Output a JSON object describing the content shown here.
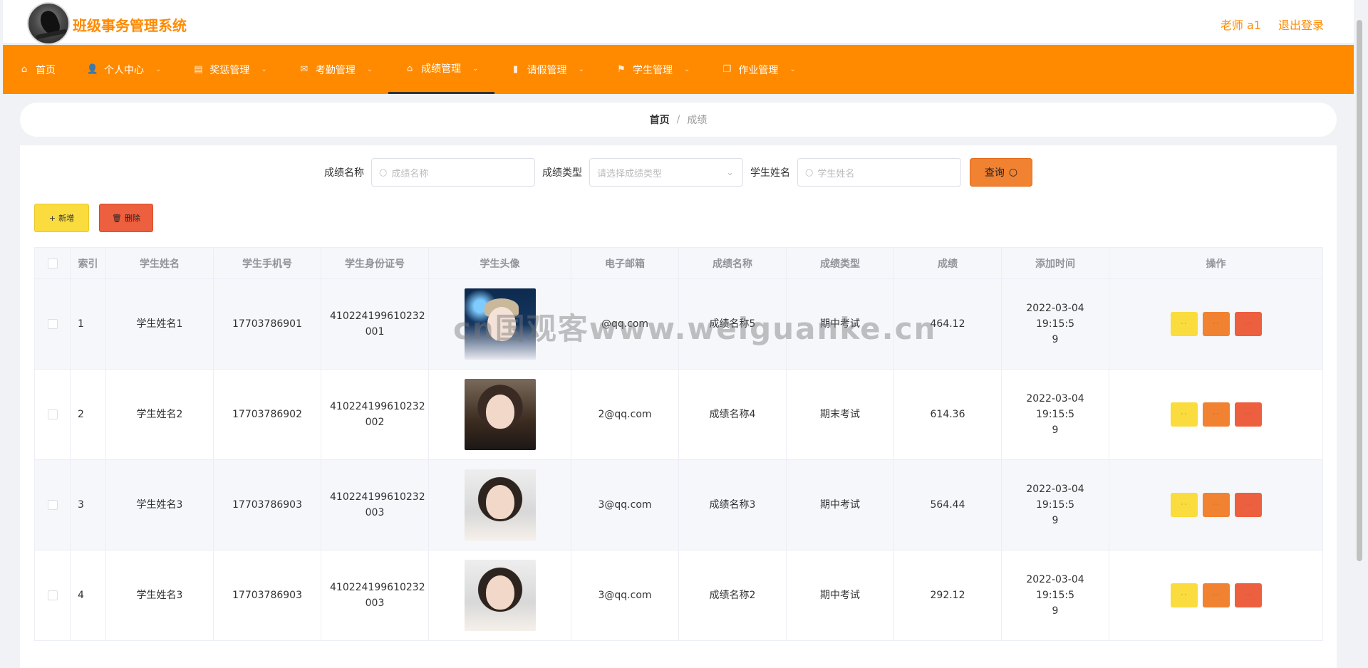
{
  "app": {
    "title": "班级事务管理系统",
    "user_label": "老师 a1",
    "logout_label": "退出登录"
  },
  "nav": [
    {
      "label": "首页",
      "icon": "home-icon",
      "glyph": "⌂",
      "active": false
    },
    {
      "label": "个人中心",
      "icon": "user-icon",
      "glyph": "👤",
      "active": false
    },
    {
      "label": "奖惩管理",
      "icon": "clipboard-icon",
      "glyph": "▤",
      "active": false
    },
    {
      "label": "考勤管理",
      "icon": "mail-icon",
      "glyph": "✉",
      "active": false
    },
    {
      "label": "成绩管理",
      "icon": "home-fill-icon",
      "glyph": "⌂",
      "active": true
    },
    {
      "label": "请假管理",
      "icon": "bar-chart-icon",
      "glyph": "▮",
      "active": false
    },
    {
      "label": "学生管理",
      "icon": "flag-icon",
      "glyph": "⚑",
      "active": false
    },
    {
      "label": "作业管理",
      "icon": "copy-icon",
      "glyph": "❐",
      "active": false
    }
  ],
  "breadcrumb": {
    "home": "首页",
    "separator": "/",
    "current": "成绩"
  },
  "search": {
    "name_label": "成绩名称",
    "name_placeholder": "成绩名称",
    "type_label": "成绩类型",
    "type_placeholder": "请选择成绩类型",
    "student_label": "学生姓名",
    "student_placeholder": "学生姓名",
    "query_label": "查询"
  },
  "actions": {
    "add_label": "新增",
    "delete_label": "删除"
  },
  "table": {
    "headers": [
      "索引",
      "学生姓名",
      "学生手机号",
      "学生身份证号",
      "学生头像",
      "电子邮箱",
      "成绩名称",
      "成绩类型",
      "成绩",
      "添加时间",
      "操作"
    ],
    "rows": [
      {
        "index": "1",
        "name": "学生姓名1",
        "phone": "17703786901",
        "id_line1": "410224199610232",
        "id_line2": "001",
        "email": "@qq.com",
        "score_name": "成绩名称5",
        "score_type": "期中考试",
        "score": "464.12",
        "time_line1": "2022-03-04 19:15:5",
        "time_line2": "9",
        "avatar": "av1"
      },
      {
        "index": "2",
        "name": "学生姓名2",
        "phone": "17703786902",
        "id_line1": "410224199610232",
        "id_line2": "002",
        "email": "2@qq.com",
        "score_name": "成绩名称4",
        "score_type": "期末考试",
        "score": "614.36",
        "time_line1": "2022-03-04 19:15:5",
        "time_line2": "9",
        "avatar": "av2"
      },
      {
        "index": "3",
        "name": "学生姓名3",
        "phone": "17703786903",
        "id_line1": "410224199610232",
        "id_line2": "003",
        "email": "3@qq.com",
        "score_name": "成绩名称3",
        "score_type": "期中考试",
        "score": "564.44",
        "time_line1": "2022-03-04 19:15:5",
        "time_line2": "9",
        "avatar": "av3"
      },
      {
        "index": "4",
        "name": "学生姓名3",
        "phone": "17703786903",
        "id_line1": "410224199610232",
        "id_line2": "003",
        "email": "3@qq.com",
        "score_name": "成绩名称2",
        "score_type": "期中考试",
        "score": "292.12",
        "time_line1": "2022-03-04 19:15:5",
        "time_line2": "9",
        "avatar": "av3"
      }
    ]
  },
  "watermark": "cn国观客www.weiguanke.cn",
  "colors": {
    "brand": "#ff8a00",
    "add": "#fadc3f",
    "query": "#f08232",
    "delete": "#ec5f3f"
  }
}
